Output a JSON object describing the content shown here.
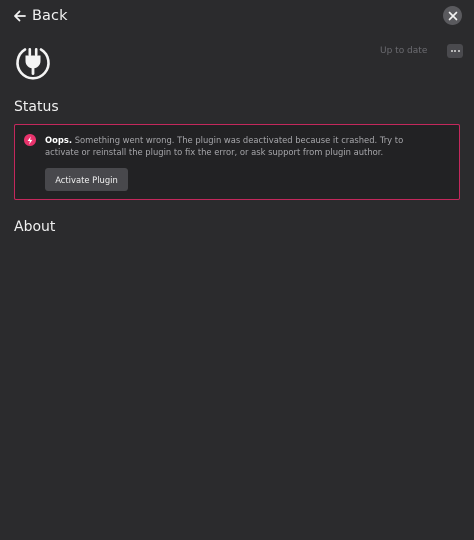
{
  "header": {
    "back_label": "Back"
  },
  "plugin": {
    "update_status": "Up to date"
  },
  "sections": {
    "status_title": "Status",
    "about_title": "About"
  },
  "error": {
    "title": "Oops.",
    "message": "Something went wrong. The plugin was deactivated because it crashed. Try to activate or reinstall the plugin to fix the error, or ask support from plugin author.",
    "action_label": "Activate Plugin"
  },
  "colors": {
    "background": "#2b2b2d",
    "error_border": "#c4285c",
    "error_icon": "#e8336c",
    "button_bg": "#48484c"
  },
  "icons": {
    "back": "arrow-left-icon",
    "close": "close-icon",
    "plugin": "plug-icon",
    "more": "more-horizontal-icon",
    "error": "lightning-bolt-icon"
  }
}
